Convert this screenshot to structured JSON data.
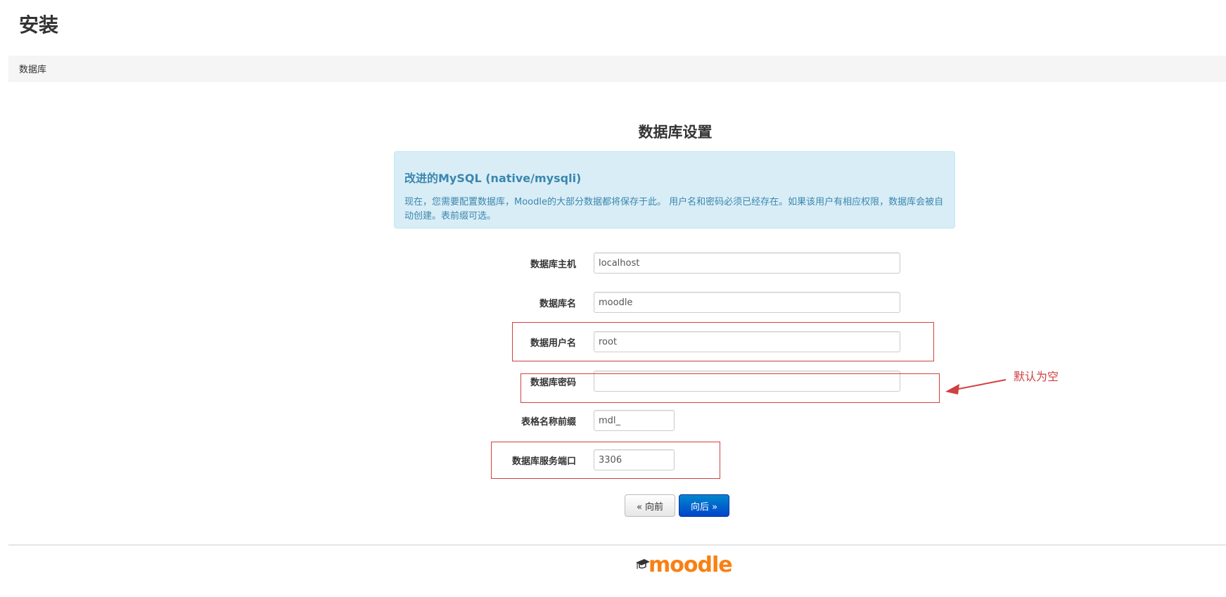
{
  "header": {
    "title": "安装"
  },
  "breadcrumb": {
    "current": "数据库"
  },
  "main": {
    "section_title": "数据库设置",
    "info": {
      "heading": "改进的MySQL (native/mysqli)",
      "text": "现在，您需要配置数据库，Moodle的大部分数据都将保存于此。 用户名和密码必须已经存在。如果该用户有相应权限，数据库会被自动创建。表前缀可选。"
    },
    "fields": [
      {
        "label": "数据库主机",
        "value": "localhost"
      },
      {
        "label": "数据库名",
        "value": "moodle"
      },
      {
        "label": "数据用户名",
        "value": "root"
      },
      {
        "label": "数据库密码",
        "value": ""
      },
      {
        "label": "表格名称前缀",
        "value": "mdl_"
      },
      {
        "label": "数据库服务端口",
        "value": "3306"
      }
    ],
    "buttons": {
      "prev": "« 向前",
      "next": "向后 »"
    }
  },
  "annotation": {
    "text": "默认为空",
    "color": "#d04040"
  },
  "footer": {
    "logo_text": "moodle",
    "logo_color": "#f98012"
  },
  "colors": {
    "info_bg": "#d9edf7",
    "info_text": "#3a87ad",
    "primary_button": "#0055cc"
  }
}
